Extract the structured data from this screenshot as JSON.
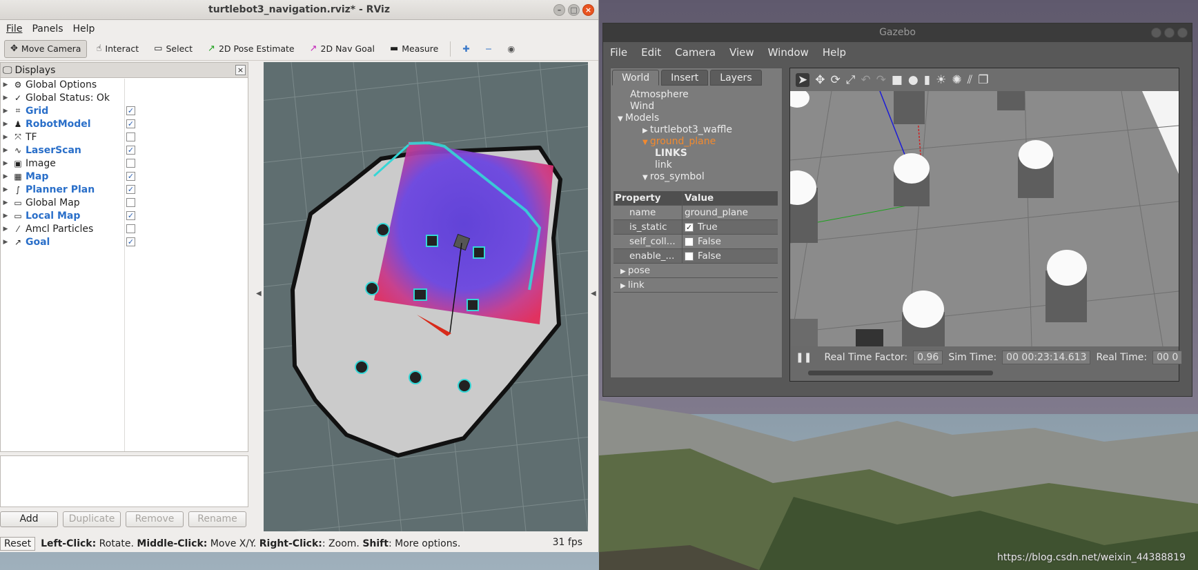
{
  "rviz": {
    "title": "turtlebot3_navigation.rviz* - RViz",
    "menu": [
      "File",
      "Panels",
      "Help"
    ],
    "toolbar": [
      {
        "label": "Move Camera",
        "icon": "move-camera-icon",
        "glyph": "✥",
        "active": true
      },
      {
        "label": "Interact",
        "icon": "hand-icon",
        "glyph": "☝"
      },
      {
        "label": "Select",
        "icon": "select-rect-icon",
        "glyph": "▭"
      },
      {
        "label": "2D Pose Estimate",
        "icon": "pose-arrow-icon",
        "glyph": "↗",
        "color": "#1aa01a"
      },
      {
        "label": "2D Nav Goal",
        "icon": "goal-arrow-icon",
        "glyph": "↗",
        "color": "#c21fb8"
      },
      {
        "label": "Measure",
        "icon": "ruler-icon",
        "glyph": "▬"
      }
    ],
    "displays_title": "Displays",
    "displays": [
      {
        "label": "Global Options",
        "icon": "⚙",
        "blue": false,
        "check": null
      },
      {
        "label": "Global Status: Ok",
        "icon": "✓",
        "blue": false,
        "check": null
      },
      {
        "label": "Grid",
        "icon": "⌗",
        "blue": true,
        "check": true
      },
      {
        "label": "RobotModel",
        "icon": "♟",
        "blue": true,
        "check": true
      },
      {
        "label": "TF",
        "icon": "⤧",
        "blue": false,
        "check": false
      },
      {
        "label": "LaserScan",
        "icon": "∿",
        "blue": true,
        "check": true
      },
      {
        "label": "Image",
        "icon": "▣",
        "blue": false,
        "check": false
      },
      {
        "label": "Map",
        "icon": "▦",
        "blue": true,
        "check": true
      },
      {
        "label": "Planner Plan",
        "icon": "∫",
        "blue": true,
        "check": true
      },
      {
        "label": "Global Map",
        "icon": "▭",
        "blue": false,
        "check": false
      },
      {
        "label": "Local Map",
        "icon": "▭",
        "blue": true,
        "check": true
      },
      {
        "label": "Amcl Particles",
        "icon": "⁄",
        "blue": false,
        "check": false
      },
      {
        "label": "Goal",
        "icon": "↗",
        "blue": true,
        "check": true
      }
    ],
    "buttons": {
      "add": "Add",
      "duplicate": "Duplicate",
      "remove": "Remove",
      "rename": "Rename"
    },
    "status": {
      "reset": "Reset",
      "hint_parts": [
        {
          "b": "Left-Click:",
          "t": " Rotate. "
        },
        {
          "b": "Middle-Click:",
          "t": " Move X/Y. "
        },
        {
          "b": "Right-Click:",
          "t": ": Zoom. "
        },
        {
          "b": "Shift",
          "t": ": More options."
        }
      ],
      "fps": "31 fps"
    }
  },
  "gazebo": {
    "title": "Gazebo",
    "menu": [
      "File",
      "Edit",
      "Camera",
      "View",
      "Window",
      "Help"
    ],
    "tabs": [
      "World",
      "Insert",
      "Layers"
    ],
    "tree": [
      {
        "label": "Atmosphere",
        "indent": 1,
        "arrow": ""
      },
      {
        "label": "Wind",
        "indent": 1,
        "arrow": ""
      },
      {
        "label": "Models",
        "indent": 0,
        "arrow": "▼"
      },
      {
        "label": "turtlebot3_waffle",
        "indent": 2,
        "arrow": "▶"
      },
      {
        "label": "ground_plane",
        "indent": 2,
        "arrow": "▼",
        "selected": true
      },
      {
        "label": "LINKS",
        "indent": 3,
        "arrow": "",
        "bold": true
      },
      {
        "label": "link",
        "indent": 3,
        "arrow": ""
      },
      {
        "label": "ros_symbol",
        "indent": 2,
        "arrow": "▼"
      }
    ],
    "properties": {
      "header": [
        "Property",
        "Value"
      ],
      "rows": [
        {
          "key": "name",
          "value": "ground_plane",
          "checkbox": null
        },
        {
          "key": "is_static",
          "value": "True",
          "checkbox": true
        },
        {
          "key": "self_coll...",
          "value": "False",
          "checkbox": false
        },
        {
          "key": "enable_...",
          "value": "False",
          "checkbox": false
        }
      ],
      "expandable": [
        "pose",
        "link"
      ]
    },
    "bottom": {
      "rtf_label": "Real Time Factor:",
      "rtf_value": "0.96",
      "sim_label": "Sim Time:",
      "sim_value": "00 00:23:14.613",
      "real_label": "Real Time:",
      "real_value": "00 0"
    }
  },
  "watermark": "https://blog.csdn.net/weixin_44388819"
}
